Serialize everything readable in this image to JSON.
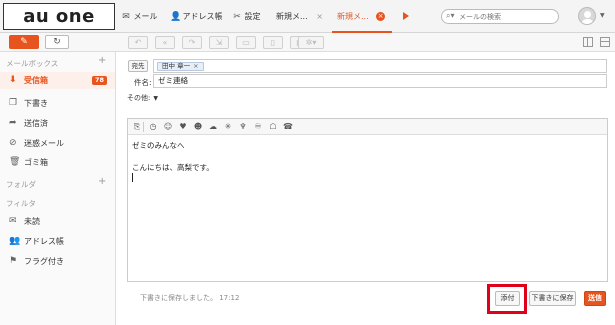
{
  "brand": {
    "logo_text": "au one net",
    "accent": "#e8541e",
    "highlight_color": "#e0001a"
  },
  "nav": {
    "tabs": [
      {
        "icon": "mail-icon",
        "label": "メール"
      },
      {
        "icon": "address-book-icon",
        "label": "アドレス帳"
      },
      {
        "icon": "tools-icon",
        "label": "設定"
      },
      {
        "icon": "",
        "label": "新規メ...",
        "close": "×"
      },
      {
        "icon": "",
        "label": "新規メ...",
        "close": "×",
        "active": true
      }
    ],
    "search": {
      "placeholder": "メールの検索"
    }
  },
  "sidebar": {
    "mailbox_header": "メールボックス",
    "folders": [
      {
        "icon": "inbox-icon",
        "label": "受信箱",
        "badge": "78",
        "selected": true
      },
      {
        "icon": "draft-icon",
        "label": "下書き"
      },
      {
        "icon": "sent-icon",
        "label": "送信済"
      },
      {
        "icon": "spam-icon",
        "label": "迷惑メール"
      },
      {
        "icon": "trash-icon",
        "label": "ゴミ箱"
      }
    ],
    "folder_header": "フォルダ",
    "filter_header": "フィルタ",
    "filters": [
      {
        "icon": "unread-icon",
        "label": "未読"
      },
      {
        "icon": "contacts-icon",
        "label": "アドレス帳"
      },
      {
        "icon": "flag-icon",
        "label": "フラグ付き"
      }
    ]
  },
  "compose": {
    "to_button": "宛先",
    "to_recipient": "田中 章一",
    "subject_label": "件名:",
    "subject": "ゼミ連絡",
    "other_label": "その他:",
    "body_lines": [
      "ゼミのみんなへ",
      "",
      "こんにちは、高梨です。"
    ],
    "draft_saved_text": "下書きに保存しました。 17:12",
    "attach_label": "添付",
    "save_draft_label": "下書きに保存",
    "send_label": "送信"
  }
}
